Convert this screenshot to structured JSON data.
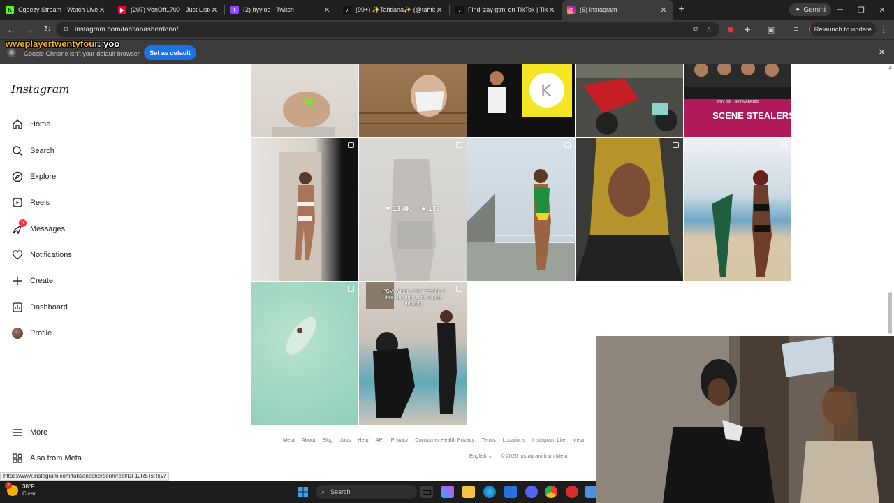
{
  "browser": {
    "tabs": [
      {
        "title": "Cgeezy Stream - Watch Live on",
        "favicon": "kick-icon",
        "color": "#53fc18"
      },
      {
        "title": "(207) VonOff1700 - Just Listen t",
        "favicon": "youtube-icon",
        "color": "#ff0033"
      },
      {
        "title": "(2) hyyjoe - Twitch",
        "favicon": "twitch-icon",
        "color": "#9146ff"
      },
      {
        "title": "(99+) ✨Tahtiana✨ (@tahtiana",
        "favicon": "tiktok-icon",
        "color": "#111111"
      },
      {
        "title": "Find 'zay gtm' on TikTok | TikTo",
        "favicon": "tiktok-icon",
        "color": "#111111"
      },
      {
        "title": "(6) Instagram",
        "favicon": "instagram-icon",
        "color": "#d62976",
        "active": true
      }
    ],
    "gemini_label": "Gemini",
    "url": "instagram.com/tahtianasherdenn/",
    "relaunch_label": "Relaunch to update",
    "infobar": {
      "message": "Google Chrome isn't your default browser",
      "button": "Set as default"
    },
    "status_url": "https://www.instagram.com/tahtianasherdenn/reel/DF1JR5TsRxV/"
  },
  "chat_overlay": {
    "user": "wweplayertwentyfour",
    "message": ": yoo"
  },
  "instagram": {
    "logo": "Instagram",
    "nav": [
      {
        "label": "Home",
        "icon": "home-icon"
      },
      {
        "label": "Search",
        "icon": "search-icon"
      },
      {
        "label": "Explore",
        "icon": "compass-icon"
      },
      {
        "label": "Reels",
        "icon": "reels-icon"
      },
      {
        "label": "Messages",
        "icon": "messenger-icon",
        "badge": "6"
      },
      {
        "label": "Notifications",
        "icon": "heart-icon"
      },
      {
        "label": "Create",
        "icon": "plus-icon"
      },
      {
        "label": "Dashboard",
        "icon": "dashboard-icon"
      },
      {
        "label": "Profile",
        "icon": "avatar"
      }
    ],
    "more_label": "More",
    "also_from_meta_label": "Also from Meta",
    "hover_stats": {
      "likes": "13.4K",
      "comments": "139"
    },
    "reel_caption": "POV: When Y'all made the 2 little kids fight at the family function",
    "post_title_text": "SCENE STEALERS",
    "post_title_small": "WHY DID I GET MARRIED",
    "footer_links": [
      "Meta",
      "About",
      "Blog",
      "Jobs",
      "Help",
      "API",
      "Privacy",
      "Consumer Health Privacy",
      "Terms",
      "Locations",
      "Instagram Lite",
      "Meta"
    ],
    "language": "English",
    "copyright": "© 2026 Instagram from Meta"
  },
  "taskbar": {
    "weather_temp": "38°F",
    "weather_cond": "Clear",
    "weather_badge": "2",
    "search_placeholder": "Search"
  },
  "colors": {
    "chrome_dark": "#1f1f1f",
    "toolbar": "#3c3c3c",
    "set_default_blue": "#1a73e8",
    "badge_red": "#ff3040"
  }
}
